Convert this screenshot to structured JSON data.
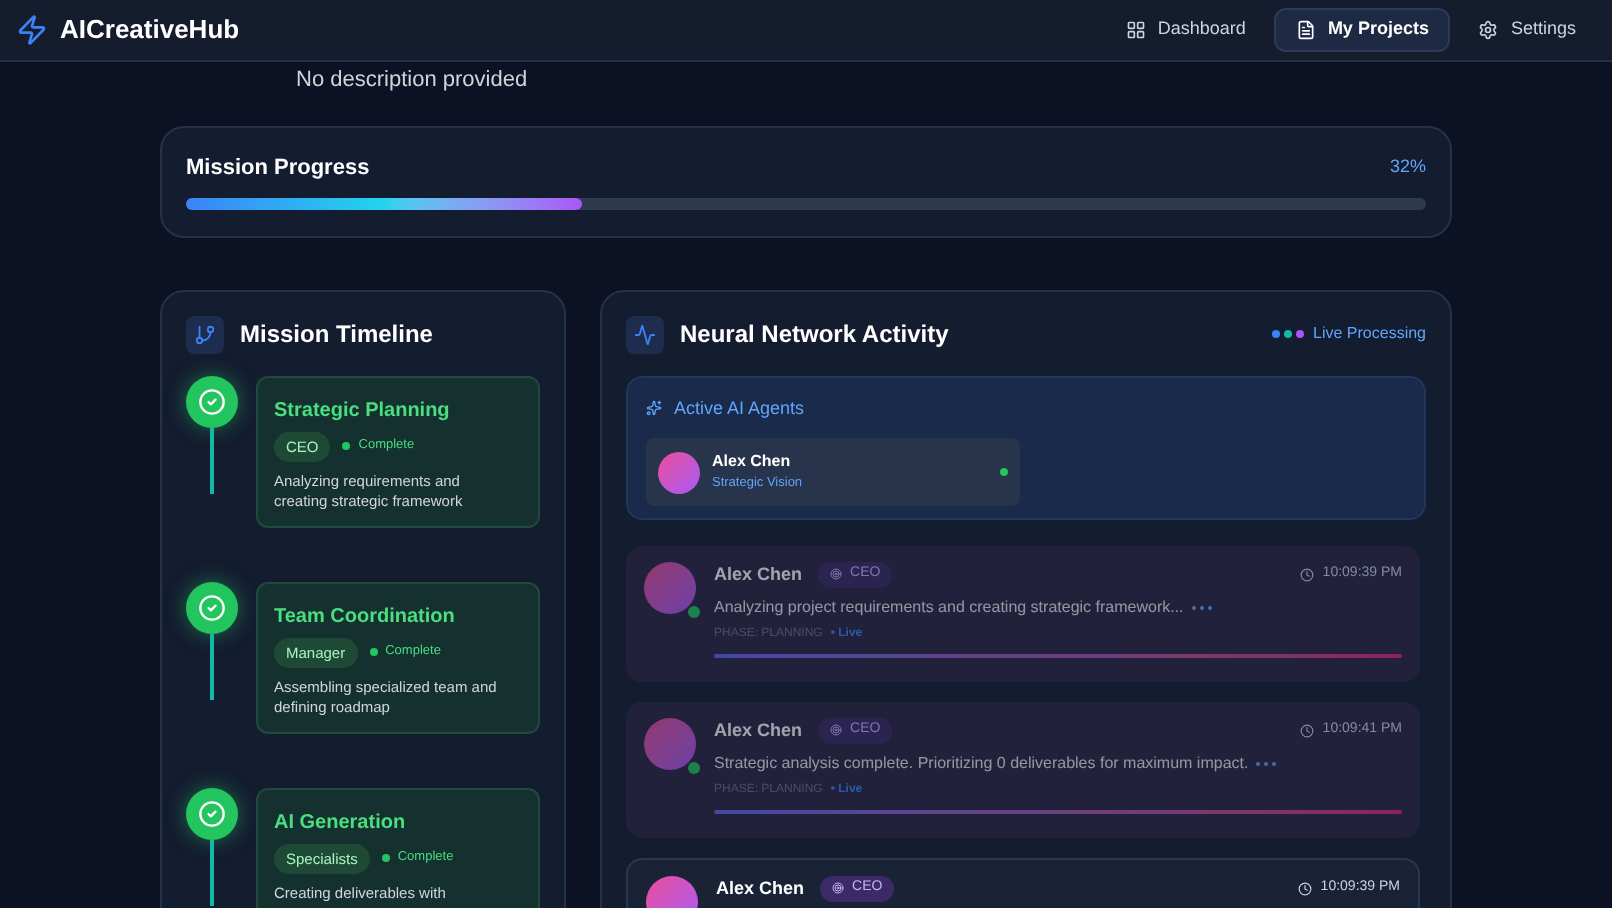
{
  "brand": {
    "name": "AICreativeHub"
  },
  "nav": [
    {
      "label": "Dashboard",
      "kind": "grid",
      "selected": false
    },
    {
      "label": "My Projects",
      "kind": "file",
      "selected": true
    },
    {
      "label": "Settings",
      "kind": "gear",
      "selected": false
    }
  ],
  "project": {
    "description": "No description provided"
  },
  "progress": {
    "title": "Mission Progress",
    "reading": "32%",
    "level": 0.32
  },
  "timeline": {
    "title": "Mission Timeline",
    "steps": [
      {
        "title": "Strategic Planning",
        "role": "CEO",
        "status": "Complete",
        "complete": true,
        "description": "Analyzing requirements and creating strategic framework"
      },
      {
        "title": "Team Coordination",
        "role": "Manager",
        "status": "Complete",
        "complete": true,
        "description": "Assembling specialized team and defining roadmap"
      },
      {
        "title": "AI Generation",
        "role": "Specialists",
        "status": "Complete",
        "complete": true,
        "description": "Creating deliverables with"
      }
    ]
  },
  "activity": {
    "title": "Neural Network Activity",
    "live_label": "Live Processing",
    "agents_title": "Active AI Agents",
    "agents": [
      {
        "name": "Alex Chen",
        "role": "Strategic Vision",
        "online": true
      }
    ],
    "messages": [
      {
        "name": "Alex Chen",
        "role": "CEO",
        "time": "10:09:39 PM",
        "text": "Analyzing project requirements and creating strategic framework...",
        "phase": "PHASE: PLANNING",
        "live": "• Live",
        "dimmed": true
      },
      {
        "name": "Alex Chen",
        "role": "CEO",
        "time": "10:09:41 PM",
        "text": "Strategic analysis complete. Prioritizing 0 deliverables for maximum impact.",
        "phase": "PHASE: PLANNING",
        "live": "• Live",
        "dimmed": true
      },
      {
        "name": "Alex Chen",
        "role": "CEO",
        "time": "10:09:39 PM",
        "dimmed": false
      }
    ]
  }
}
